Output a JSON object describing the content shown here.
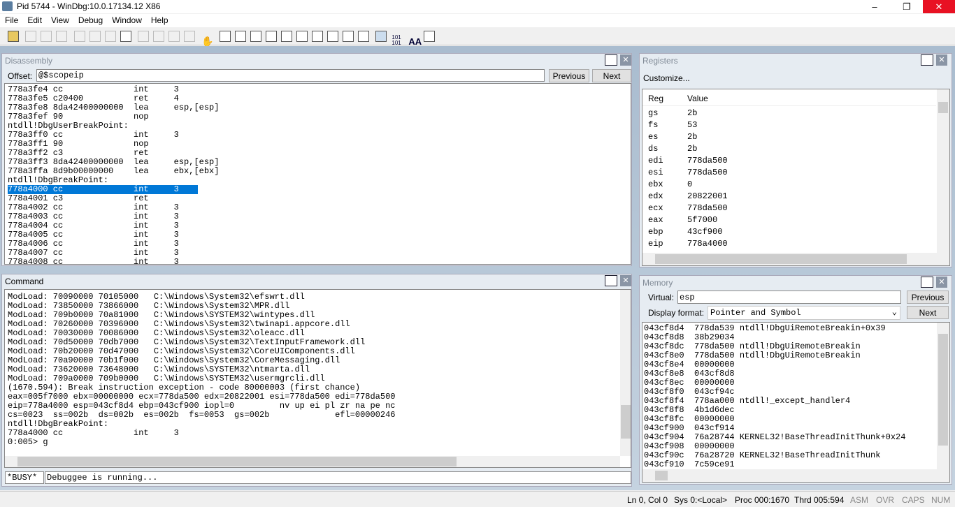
{
  "window": {
    "title": "Pid 5744 - WinDbg:10.0.17134.12 X86",
    "minimize": "–",
    "maximize": "❐",
    "close": "✕"
  },
  "menu": [
    "File",
    "Edit",
    "View",
    "Debug",
    "Window",
    "Help"
  ],
  "disassembly": {
    "title": "Disassembly",
    "offset_label": "Offset:",
    "offset_value": "@$scopeip",
    "previous": "Previous",
    "next": "Next",
    "lines": [
      "778a3fe4 cc              int     3",
      "778a3fe5 c20400          ret     4",
      "778a3fe8 8da42400000000  lea     esp,[esp]",
      "778a3fef 90              nop",
      "ntdll!DbgUserBreakPoint:",
      "778a3ff0 cc              int     3",
      "778a3ff1 90              nop",
      "778a3ff2 c3              ret",
      "778a3ff3 8da42400000000  lea     esp,[esp]",
      "778a3ffa 8d9b00000000    lea     ebx,[ebx]",
      "ntdll!DbgBreakPoint:",
      "778a4000 cc              int     3",
      "778a4001 c3              ret",
      "778a4002 cc              int     3",
      "778a4003 cc              int     3",
      "778a4004 cc              int     3",
      "778a4005 cc              int     3",
      "778a4006 cc              int     3",
      "778a4007 cc              int     3",
      "778a4008 cc              int     3"
    ],
    "selected_index": 11
  },
  "registers": {
    "title": "Registers",
    "customize": "Customize...",
    "col_reg": "Reg",
    "col_value": "Value",
    "rows": [
      [
        "gs",
        "2b"
      ],
      [
        "fs",
        "53"
      ],
      [
        "es",
        "2b"
      ],
      [
        "ds",
        "2b"
      ],
      [
        "edi",
        "778da500"
      ],
      [
        "esi",
        "778da500"
      ],
      [
        "ebx",
        "0"
      ],
      [
        "edx",
        "20822001"
      ],
      [
        "ecx",
        "778da500"
      ],
      [
        "eax",
        "5f7000"
      ],
      [
        "ebp",
        "43cf900"
      ],
      [
        "eip",
        "778a4000"
      ]
    ]
  },
  "command": {
    "title": "Command",
    "busy": "*BUSY*",
    "status_text": "Debuggee is running...",
    "lines": [
      "ModLoad: 70090000 70105000   C:\\Windows\\System32\\efswrt.dll",
      "ModLoad: 73850000 73866000   C:\\Windows\\System32\\MPR.dll",
      "ModLoad: 709b0000 70a81000   C:\\Windows\\SYSTEM32\\wintypes.dll",
      "ModLoad: 70260000 70396000   C:\\Windows\\System32\\twinapi.appcore.dll",
      "ModLoad: 70030000 70086000   C:\\Windows\\System32\\oleacc.dll",
      "ModLoad: 70d50000 70db7000   C:\\Windows\\System32\\TextInputFramework.dll",
      "ModLoad: 70b20000 70d47000   C:\\Windows\\System32\\CoreUIComponents.dll",
      "ModLoad: 70a90000 70b1f000   C:\\Windows\\System32\\CoreMessaging.dll",
      "ModLoad: 73620000 73648000   C:\\Windows\\SYSTEM32\\ntmarta.dll",
      "ModLoad: 709a0000 709b0000   C:\\Windows\\SYSTEM32\\usermgrcli.dll",
      "(1670.594): Break instruction exception - code 80000003 (first chance)",
      "eax=005f7000 ebx=00000000 ecx=778da500 edx=20822001 esi=778da500 edi=778da500",
      "eip=778a4000 esp=043cf8d4 ebp=043cf900 iopl=0         nv up ei pl zr na pe nc",
      "cs=0023  ss=002b  ds=002b  es=002b  fs=0053  gs=002b             efl=00000246",
      "ntdll!DbgBreakPoint:",
      "778a4000 cc              int     3",
      "0:005> g"
    ]
  },
  "memory": {
    "title": "Memory",
    "virtual_label": "Virtual:",
    "virtual_value": "esp",
    "format_label": "Display format:",
    "format_value": "Pointer and Symbol",
    "previous": "Previous",
    "next": "Next",
    "lines": [
      "043cf8d4  778da539 ntdll!DbgUiRemoteBreakin+0x39",
      "043cf8d8  38b29034",
      "043cf8dc  778da500 ntdll!DbgUiRemoteBreakin",
      "043cf8e0  778da500 ntdll!DbgUiRemoteBreakin",
      "043cf8e4  00000000",
      "043cf8e8  043cf8d8",
      "043cf8ec  00000000",
      "043cf8f0  043cf94c",
      "043cf8f4  778aa000 ntdll!_except_handler4",
      "043cf8f8  4b1d6dec",
      "043cf8fc  00000000",
      "043cf900  043cf914",
      "043cf904  76a28744 KERNEL32!BaseThreadInitThunk+0x24",
      "043cf908  00000000",
      "043cf90c  76a28720 KERNEL32!BaseThreadInitThunk",
      "043cf910  7c59ce91"
    ]
  },
  "statusbar": {
    "ln_col": "Ln 0, Col 0",
    "sys": "Sys 0:<Local>",
    "proc": "Proc 000:1670",
    "thrd": "Thrd 005:594",
    "asm": "ASM",
    "ovr": "OVR",
    "caps": "CAPS",
    "num": "NUM"
  },
  "colors": {
    "selection": "#0078d7",
    "desktop": "#b4c6d8",
    "close_hover": "#e81123"
  }
}
